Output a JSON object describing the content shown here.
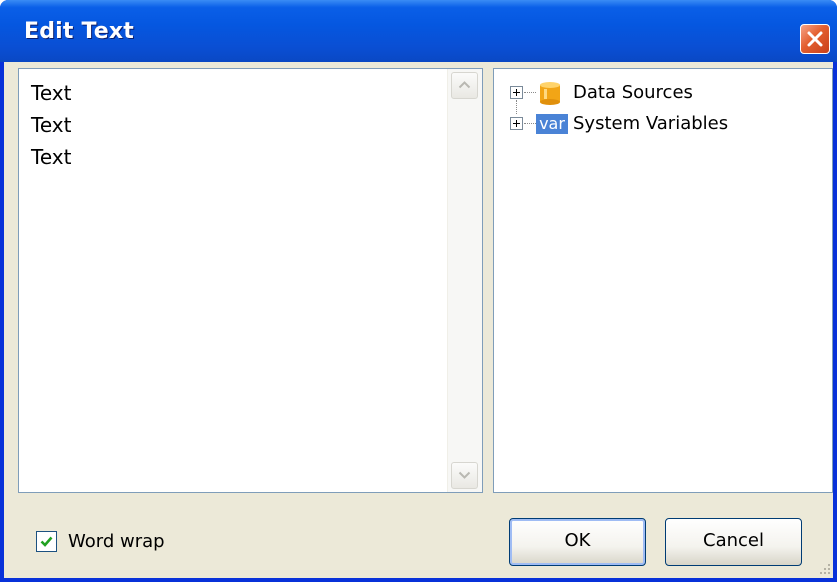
{
  "window": {
    "title": "Edit Text"
  },
  "editor": {
    "lines": [
      "Text",
      "Text",
      "Text"
    ]
  },
  "tree": {
    "items": [
      {
        "label": "Data Sources",
        "icon": "database-icon"
      },
      {
        "label": "System Variables",
        "icon": "var-icon",
        "icon_text": "var"
      }
    ]
  },
  "footer": {
    "word_wrap_label": "Word wrap",
    "word_wrap_checked": true,
    "ok_label": "OK",
    "cancel_label": "Cancel"
  },
  "colors": {
    "title_bar": "#0a5fe8",
    "close_button": "#e35f2f",
    "client_bg": "#ece9d8",
    "var_icon_bg": "#4a83d6"
  }
}
